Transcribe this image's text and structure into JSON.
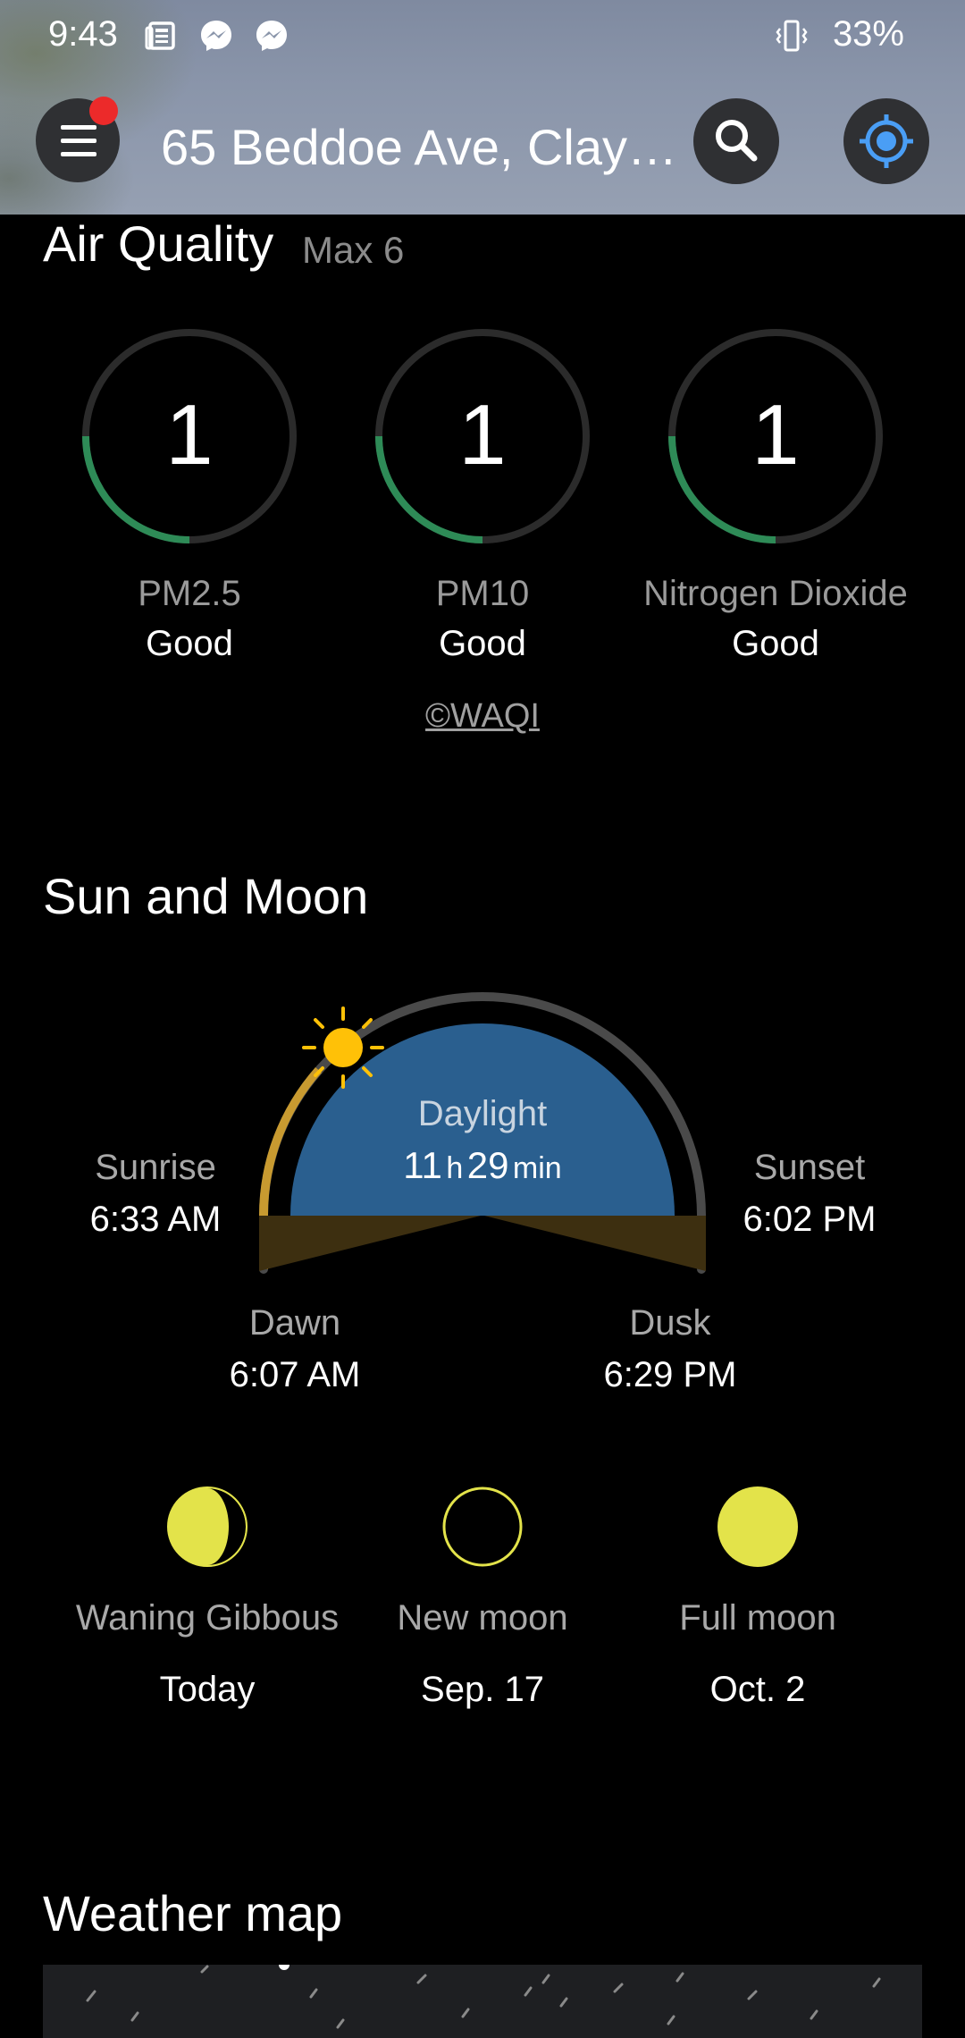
{
  "status_bar": {
    "time": "9:43",
    "icons": [
      "news-icon",
      "messenger-icon",
      "messenger-icon",
      "vibrate-icon"
    ],
    "battery": "33%"
  },
  "header": {
    "location": "65 Beddoe Ave, Clay…",
    "has_notification": true,
    "search_icon": "search-icon",
    "locate_icon": "my-location-icon",
    "menu_icon": "hamburger-menu-icon"
  },
  "air_quality": {
    "title": "Air Quality",
    "max": "Max 6",
    "source": "©WAQI",
    "items": [
      {
        "value": "1",
        "label": "PM2.5",
        "status": "Good",
        "level": 0.25,
        "color": "#2e8b57"
      },
      {
        "value": "1",
        "label": "PM10",
        "status": "Good",
        "level": 0.25,
        "color": "#2e8b57"
      },
      {
        "value": "1",
        "label": "Nitrogen Dioxide",
        "status": "Good",
        "level": 0.25,
        "color": "#2e8b57"
      }
    ]
  },
  "sun_moon": {
    "title": "Sun and Moon",
    "daylight_label": "Daylight",
    "daylight_hours": "11",
    "daylight_h_unit": "h",
    "daylight_minutes": "29",
    "daylight_min_unit": "min",
    "sunrise_label": "Sunrise",
    "sunrise_time": "6:33 AM",
    "sunset_label": "Sunset",
    "sunset_time": "6:02 PM",
    "dawn_label": "Dawn",
    "dawn_time": "6:07 AM",
    "dusk_label": "Dusk",
    "dusk_time": "6:29 PM",
    "colors": {
      "daylight": "#2a5f8f",
      "twilight": "#3d2f10",
      "sun": "#ffc107",
      "moon": "#e3e34a"
    },
    "moon_phases": [
      {
        "phase": "Waning Gibbous",
        "date": "Today",
        "type": "waning-gibbous"
      },
      {
        "phase": "New moon",
        "date": "Sep. 17",
        "type": "new"
      },
      {
        "phase": "Full moon",
        "date": "Oct. 2",
        "type": "full"
      }
    ]
  },
  "weather_map": {
    "title": "Weather map"
  }
}
